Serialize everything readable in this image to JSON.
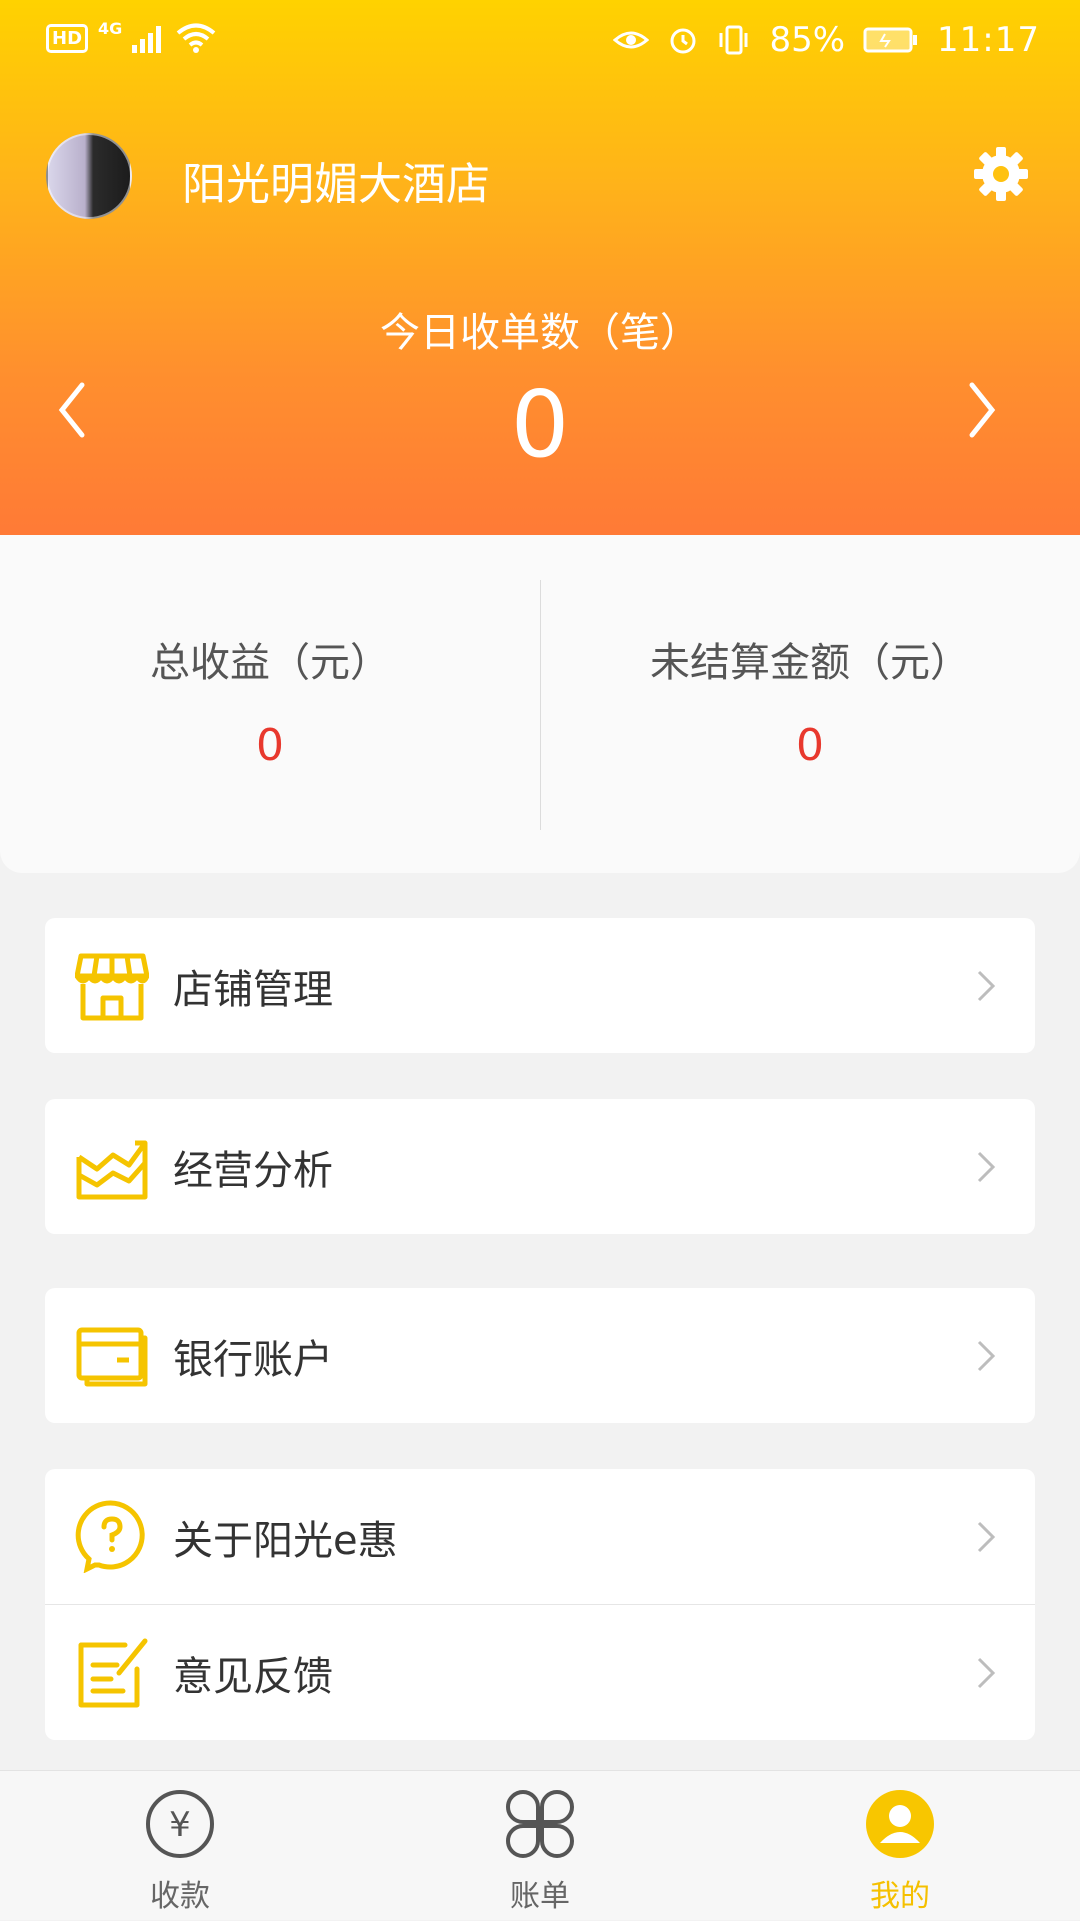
{
  "status_bar": {
    "hd": "HD",
    "network": "4G",
    "battery": "85%",
    "time": "11:17"
  },
  "header": {
    "shop_name": "阳光明媚大酒店",
    "today_label": "今日收单数（笔）",
    "today_value": "0"
  },
  "stats": {
    "total_income_label": "总收益（元）",
    "total_income_value": "0",
    "unsettled_label": "未结算金额（元）",
    "unsettled_value": "0"
  },
  "menu": {
    "shop_manage": "店铺管理",
    "business_analysis": "经营分析",
    "bank_account": "银行账户",
    "about": "关于阳光e惠",
    "feedback": "意见反馈"
  },
  "tabs": {
    "collect": "收款",
    "bills": "账单",
    "mine": "我的",
    "collect_icon_glyph": "¥"
  },
  "colors": {
    "accent_yellow": "#f5c000",
    "gradient_top": "#ffd200",
    "gradient_bottom": "#ff7a36",
    "value_red": "#e8382d"
  }
}
